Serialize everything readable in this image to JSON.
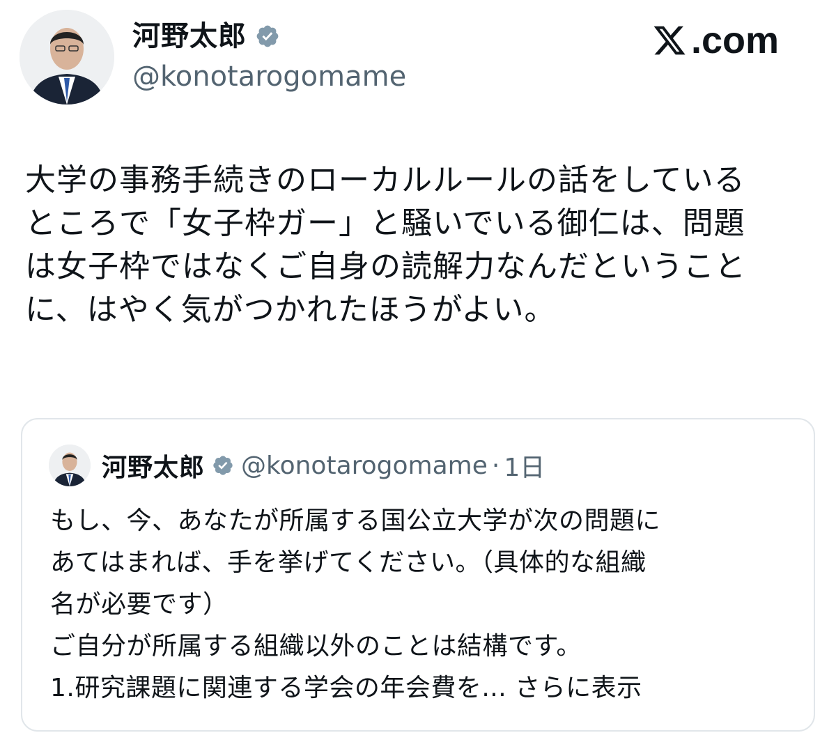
{
  "post": {
    "author": {
      "name": "河野太郎",
      "handle": "@konotarogomame",
      "verified_icon": "verified-badge-icon",
      "avatar_icon": "avatar-photo"
    },
    "brand": {
      "logo_icon": "x-logo-icon",
      "label": ".com"
    },
    "text": "大学の事務手続きのローカルルールの話をしている\nところで「女子枠ガー」と騒いでいる御仁は、問題\nは女子枠ではなくご自身の読解力なんだということ\nに、はやく気がつかれたほうがよい。"
  },
  "quote": {
    "author": {
      "name": "河野太郎",
      "handle": "@konotarogomame",
      "separator": "·",
      "time": "1日"
    },
    "text": "もし、今、あなたが所属する国公立大学が次の問題に\nあてはまれば、手を挙げてください。（具体的な組織\n名が必要です）\nご自分が所属する組織以外のことは結構です。\n1.研究課題に関連する学会の年会費を...",
    "show_more": " さらに表示"
  },
  "colors": {
    "text": "#0f1419",
    "secondary": "#536471",
    "verified_badge": "#829aab",
    "border": "#e1e6ea"
  }
}
